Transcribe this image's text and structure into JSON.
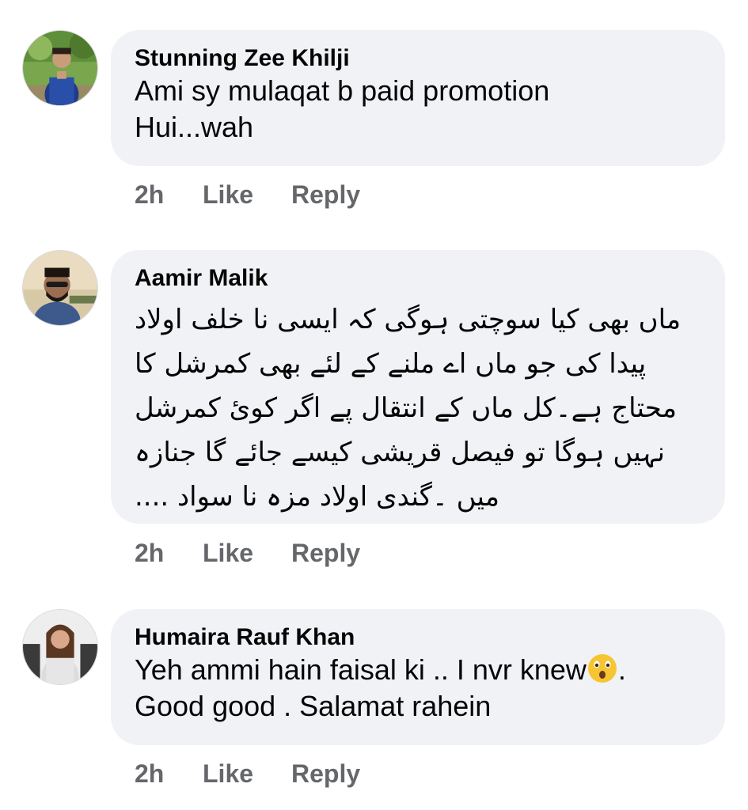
{
  "comments": [
    {
      "author": "Stunning Zee Khilji",
      "text_lines": [
        "Ami sy mulaqat b paid promotion",
        "Hui...wah"
      ],
      "time": "2h",
      "like_label": "Like",
      "reply_label": "Reply"
    },
    {
      "author": "Aamir Malik",
      "text_lines": [
        "ماں بھی کیا سوچتی ہوگی کہ ایسی نا خلف اولاد",
        "پیدا کی جو ماں اے ملنے کے لئے بھی کمرشل کا",
        "محتاج ہے۔کل ماں کے انتقال پے اگر کوئ کمرشل",
        "نہیں ہوگا تو فیصل قریشی کیسے جائے گا جنازہ",
        "میں ۔گندی اولاد   مزہ نا سواد ...."
      ],
      "time": "2h",
      "like_label": "Like",
      "reply_label": "Reply"
    },
    {
      "author": "Humaira Rauf Khan",
      "text_line1": "Yeh ammi hain faisal ki ..  I nvr knew",
      "text_line1_end": ".",
      "text_line2": "Good good . Salamat rahein",
      "emoji": "astonished-face-emoji",
      "time": "2h",
      "like_label": "Like",
      "reply_label": "Reply"
    }
  ],
  "colors": {
    "bubble": "#f0f2f5",
    "meta_text": "#65676b",
    "primary_text": "#050505"
  }
}
